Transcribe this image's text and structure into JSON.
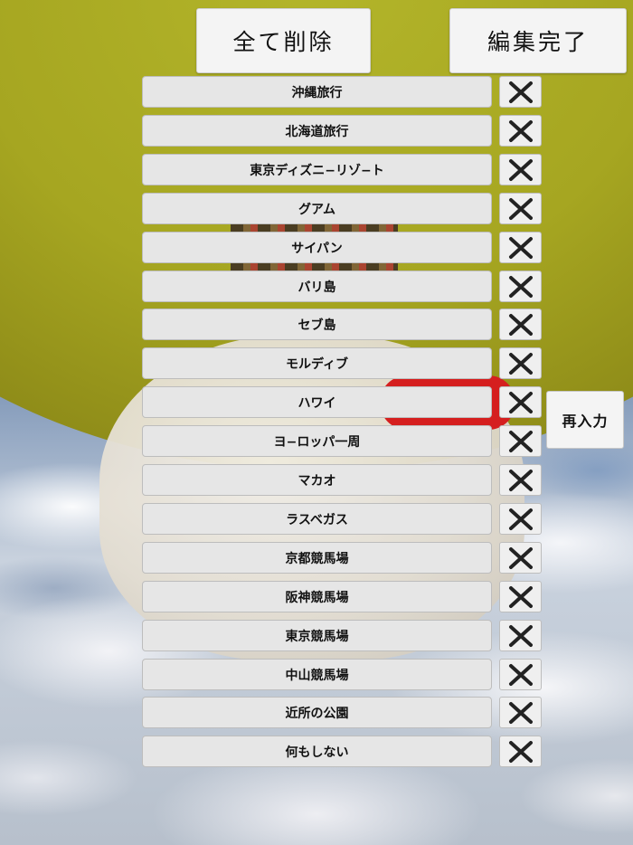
{
  "header": {
    "clear_all_label": "全て削除",
    "edit_done_label": "編集完了"
  },
  "reinput_label": "再入力",
  "delete_icon": "close-icon",
  "items": [
    {
      "label": "沖縄旅行"
    },
    {
      "label": "北海道旅行"
    },
    {
      "label": "東京ディズニ−リゾ−ト"
    },
    {
      "label": "グアム"
    },
    {
      "label": "サイパン"
    },
    {
      "label": "バリ島"
    },
    {
      "label": "セブ島"
    },
    {
      "label": "モルディブ"
    },
    {
      "label": "ハワイ"
    },
    {
      "label": "ヨ−ロッパ一周"
    },
    {
      "label": "マカオ"
    },
    {
      "label": "ラスベガス"
    },
    {
      "label": "京都競馬場"
    },
    {
      "label": "阪神競馬場"
    },
    {
      "label": "東京競馬場"
    },
    {
      "label": "中山競馬場"
    },
    {
      "label": "近所の公園"
    },
    {
      "label": "何もしない"
    }
  ],
  "colors": {
    "balloon": "#a6a621",
    "button_bg": "#e6e6e6",
    "accent_red": "#d51f1f"
  }
}
